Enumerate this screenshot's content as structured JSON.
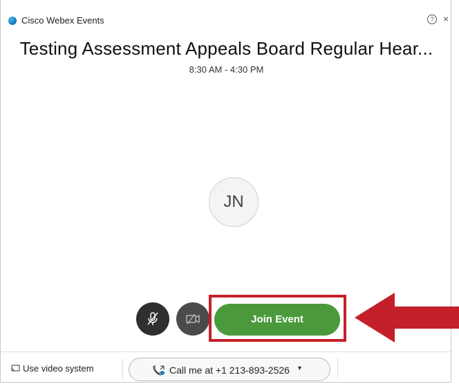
{
  "window": {
    "app_title": "Cisco Webex Events",
    "help_glyph": "?",
    "close_glyph": "×"
  },
  "meeting": {
    "title": "Testing Assessment Appeals Board Regular Hear...",
    "time": "8:30 AM - 4:30 PM",
    "avatar_initials": "JN"
  },
  "controls": {
    "join_label": "Join Event"
  },
  "footer": {
    "video_system_label": "Use video system",
    "call_me_label": "Call me at +1 213-893-2526",
    "caret": "▾"
  },
  "colors": {
    "join_green": "#4a9a3c",
    "highlight_red": "#c3202a",
    "arrow_red": "#c3202a"
  },
  "icons": [
    "app-logo-icon",
    "help-icon",
    "close-icon",
    "microphone-muted-icon",
    "video-off-icon",
    "cast-icon",
    "phone-callback-icon",
    "arrow-left-icon"
  ]
}
